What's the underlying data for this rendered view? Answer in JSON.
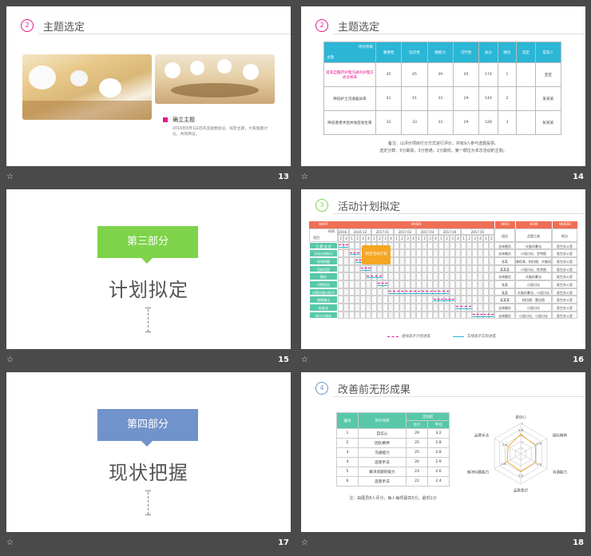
{
  "grid": [
    {
      "id": "s13",
      "number": "13"
    },
    {
      "id": "s14",
      "number": "14"
    },
    {
      "id": "s15",
      "number": "15"
    },
    {
      "id": "s16",
      "number": "16"
    },
    {
      "id": "s17",
      "number": "17"
    },
    {
      "id": "s18",
      "number": "18"
    }
  ],
  "star_glyph": "☆",
  "s13": {
    "badge": "2",
    "title": "主题选定",
    "subhead": "确立主题",
    "body": "2016年8月1日召开品管圈会议，拟定主题，大家思路讨论，共同商议。"
  },
  "s14": {
    "badge": "2",
    "title": "主题选定",
    "table": {
      "corner_top": "评价项目",
      "corner_bottom": "主题",
      "headers": [
        "重要性",
        "迫切性",
        "圈能力",
        "可行性",
        "总分",
        "顺位",
        "选定",
        "提案人"
      ],
      "rows": [
        {
          "topic": "提高自服药护理沟通的护理方式合格率",
          "cells": [
            "45",
            "45",
            "39",
            "45",
            "174",
            "1",
            "",
            "宣宣"
          ]
        },
        {
          "topic": "降低护士沟通差异率",
          "cells": [
            "41",
            "41",
            "33",
            "29",
            "144",
            "2",
            "",
            "某某某"
          ]
        },
        {
          "topic": "降低患者术后并发症发生率",
          "cells": [
            "33",
            "33",
            "33",
            "29",
            "128",
            "3",
            "",
            "张某某"
          ]
        }
      ]
    },
    "note1": "备注：以评价项目打分方式进行评价，共有9人参与选题投票。",
    "note2": "选定分数：5分最高，3分普通，1分最低，第一顺位为本次活动的主题。"
  },
  "s15": {
    "section": "第三部分",
    "title": "计划拟定"
  },
  "s16": {
    "badge": "3",
    "title": "活动计划拟定",
    "header": {
      "what": "WHAT",
      "when": "WHEN",
      "who": "WHO",
      "how": "HOW",
      "where": "WHERE"
    },
    "months": [
      "2016.11",
      "2016.12",
      "2017.01",
      "2017.02",
      "2017.03",
      "2017.04",
      "2017.05"
    ],
    "sub_col_time": "时间",
    "sub_col_item": "项目",
    "weeks": [
      "3",
      "4",
      "1",
      "2",
      "3",
      "4",
      "1",
      "2",
      "3",
      "4",
      "1",
      "2",
      "3",
      "4",
      "1",
      "2",
      "3",
      "4",
      "1",
      "2",
      "3",
      "4",
      "1",
      "2",
      "3",
      "4",
      "1",
      "2"
    ],
    "who_header": "组员",
    "how_header": "品管工具",
    "where_header": "地点",
    "rows": [
      {
        "step": "主 题 选 定",
        "who": "全体圈员",
        "how": "头脑风暴法",
        "where": "医生办公室"
      },
      {
        "step": "活动计划拟订",
        "who": "全体圈员",
        "how": "小组讨论、甘特图",
        "where": "医生办公室"
      },
      {
        "step": "现状把握",
        "who": "张某",
        "how": "查检表、柏拉图、头脑风暴",
        "where": "医生办公室"
      },
      {
        "step": "目标设定",
        "who": "某某某",
        "how": "小组讨论、柱状图",
        "where": "医生办公室"
      },
      {
        "step": "解析",
        "who": "全体圈员",
        "how": "头脑风暴法",
        "where": "医生办公室"
      },
      {
        "step": "对策拟定",
        "who": "张某",
        "how": "小组讨论",
        "where": "医生办公室"
      },
      {
        "step": "对策实施与检讨",
        "who": "某某",
        "how": "头脑风暴法、小组讨论",
        "where": "医生办公室"
      },
      {
        "step": "效果确认",
        "who": "某某某",
        "how": "柏拉图、雷达图",
        "where": "医生办公室"
      },
      {
        "step": "标准化",
        "who": "全体圈员",
        "how": "小组讨论",
        "where": "医生办公室"
      },
      {
        "step": "检讨与改进",
        "who": "全体圈员",
        "how": "小组讨论、小组讨论",
        "where": "医生办公室"
      }
    ],
    "callout": "制定活动计划",
    "legend_plan": "虚线表示计划进度",
    "legend_actual": "实线表示实际进度"
  },
  "s17": {
    "section": "第四部分",
    "title": "现状把握"
  },
  "s18": {
    "badge": "4",
    "title": "改善前无形成果",
    "table": {
      "headers": {
        "no": "编号",
        "item": "评价项目",
        "before": "活动前",
        "total": "合计",
        "avg": "平均"
      },
      "rows": [
        {
          "no": "1",
          "item": "自信心",
          "total": "29",
          "avg": "3.2"
        },
        {
          "no": "2",
          "item": "团队精神",
          "total": "25",
          "avg": "2.8"
        },
        {
          "no": "3",
          "item": "沟通能力",
          "total": "25",
          "avg": "2.8"
        },
        {
          "no": "4",
          "item": "品管手法",
          "total": "26",
          "avg": "2.9"
        },
        {
          "no": "5",
          "item": "解决问题的能力",
          "total": "23",
          "avg": "2.6"
        },
        {
          "no": "6",
          "item": "品管手法",
          "total": "22",
          "avg": "2.4"
        }
      ]
    },
    "note": "注：由圈员8人评分，每人每项最高5分，最低1分",
    "chart_data": {
      "type": "radar",
      "categories": [
        "自信心",
        "团队精神",
        "沟通能力",
        "品管意识",
        "解决问题能力",
        "品管手法"
      ],
      "values": [
        3.2,
        2.8,
        2.8,
        2.9,
        2.6,
        2.4
      ],
      "rmax": 5,
      "series_color": "#e8b03a"
    }
  },
  "colors": {
    "pink": "#e0198a",
    "teal": "#2bb6d6",
    "mint": "#58c8a8",
    "green": "#7ed34a",
    "blue": "#7193cc",
    "orange": "#ef6f55",
    "callout": "#f5a623"
  }
}
